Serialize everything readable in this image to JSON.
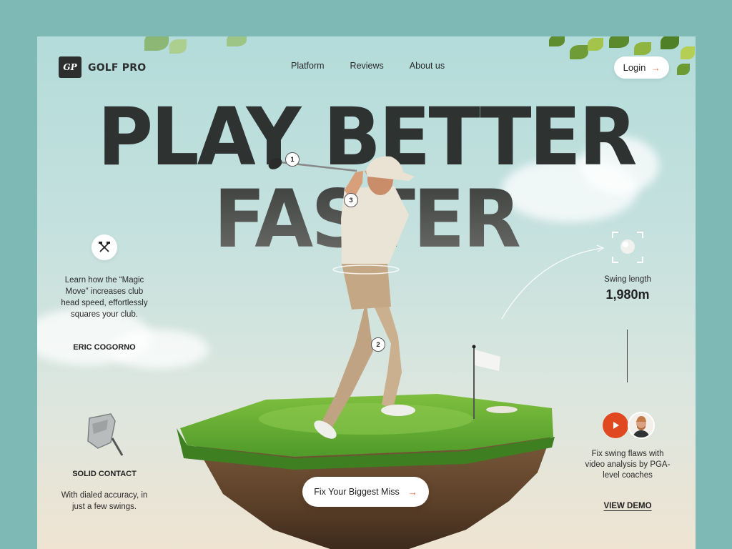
{
  "brand": {
    "logo_initials": "GP",
    "name": "GOLF PRO"
  },
  "nav": {
    "items": [
      "Platform",
      "Reviews",
      "About us"
    ]
  },
  "header": {
    "login_label": "Login"
  },
  "hero": {
    "line1": "PLAY BETTER",
    "line2": "FASTER"
  },
  "left_block": {
    "icon": "crossed-clubs-icon",
    "text": "Learn how the “Magic Move” increases club head speed, effortlessly squares your club.",
    "author": "ERIC COGORNO"
  },
  "solid_block": {
    "icon": "club-head-icon",
    "title": "SOLID CONTACT",
    "text": "With dialed accuracy, in just a few swings."
  },
  "swing_stat": {
    "label": "Swing length",
    "value": "1,980m"
  },
  "video_block": {
    "text": "Fix swing flaws with video analysis by PGA-level coaches",
    "link": "VIEW DEMO"
  },
  "cta": {
    "label": "Fix Your Biggest Miss"
  },
  "markers": [
    "1",
    "2",
    "3"
  ],
  "colors": {
    "accent": "#e55a2b",
    "dark": "#2e3331",
    "background": "#7fb9b5"
  }
}
